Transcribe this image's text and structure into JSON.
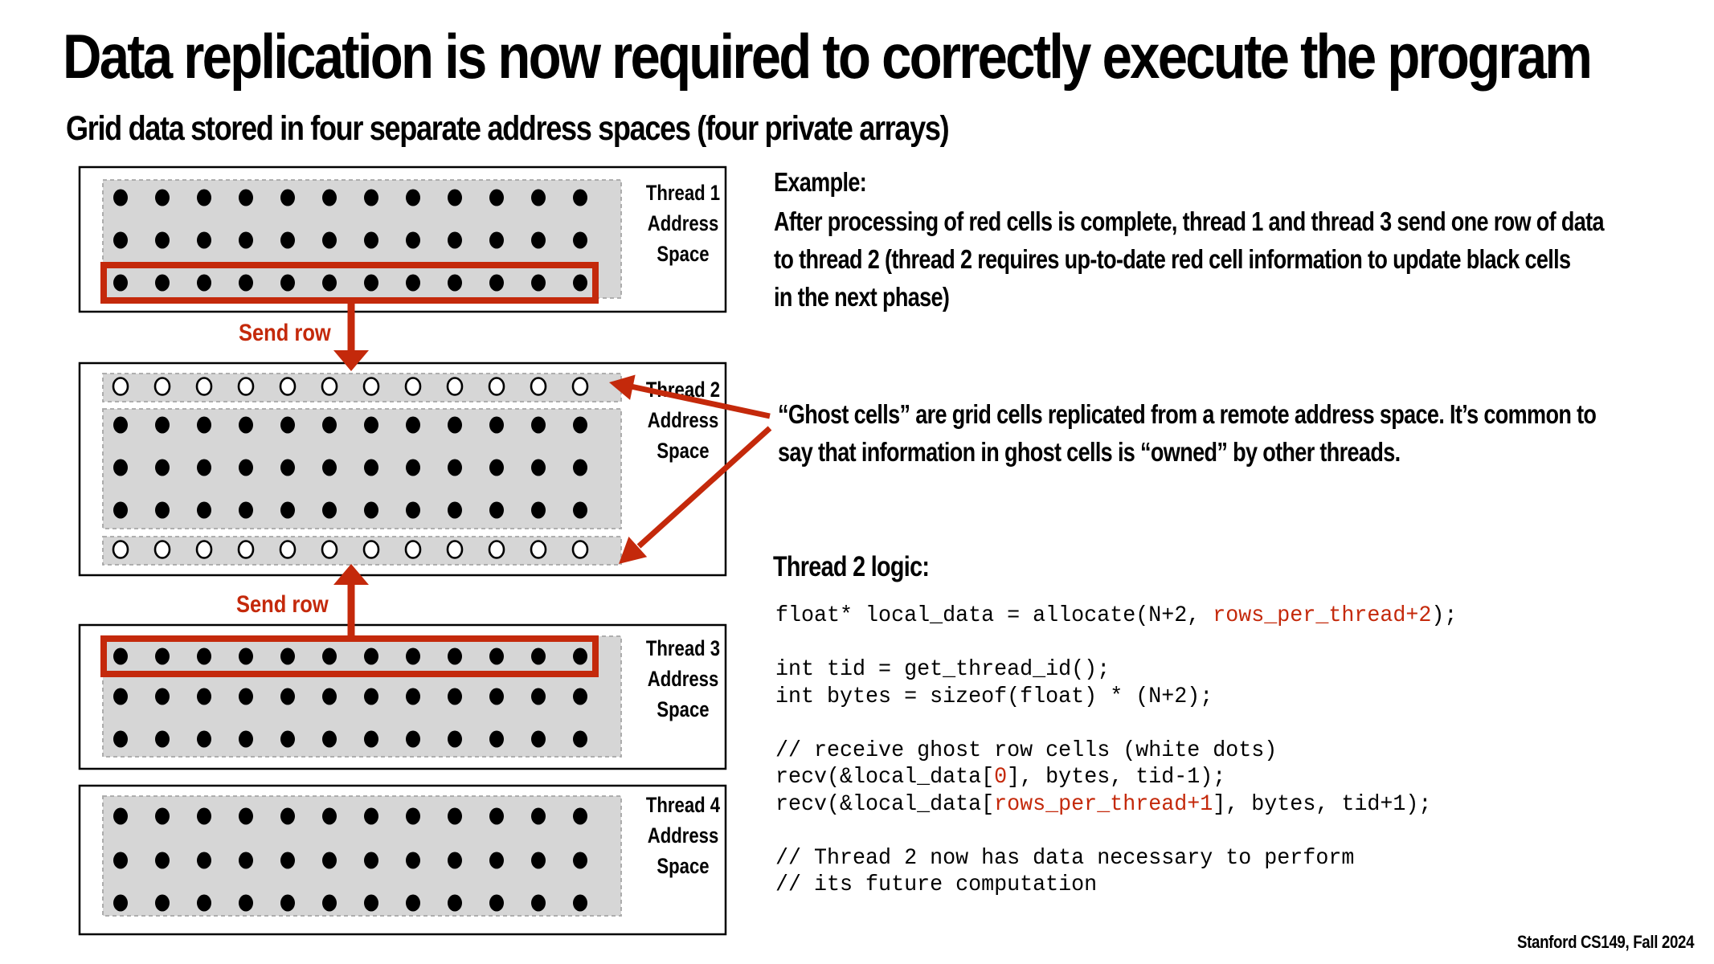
{
  "slide": {
    "title": "Data replication is now required to correctly execute the program",
    "subtitle": "Grid data stored in four separate address spaces (four private arrays)",
    "footer": "Stanford CS149, Fall 2024"
  },
  "colors": {
    "accent_red": "#c4290b",
    "grid_gray": "#d6d6d6",
    "text": "#000000"
  },
  "diagram": {
    "columns": 12,
    "threads": [
      {
        "label_lines": [
          "Thread 1",
          "Address",
          "Space"
        ],
        "rows": [
          "owned",
          "owned",
          "owned"
        ],
        "send_row_index": 2
      },
      {
        "label_lines": [
          "Thread 2",
          "Address",
          "Space"
        ],
        "rows": [
          "ghost",
          "owned",
          "owned",
          "owned",
          "ghost"
        ],
        "send_row_index": null
      },
      {
        "label_lines": [
          "Thread 3",
          "Address",
          "Space"
        ],
        "rows": [
          "owned",
          "owned",
          "owned"
        ],
        "send_row_index": 0
      },
      {
        "label_lines": [
          "Thread 4",
          "Address",
          "Space"
        ],
        "rows": [
          "owned",
          "owned",
          "owned"
        ],
        "send_row_index": null
      }
    ],
    "send_labels": [
      "Send row",
      "Send row"
    ]
  },
  "example": {
    "heading": "Example:",
    "lines": [
      "After processing of red cells is complete, thread 1 and thread 3 send one row of data",
      "to thread 2 (thread 2 requires up-to-date red cell information to update black cells",
      "in the next phase)"
    ]
  },
  "ghost_note": {
    "lines": [
      "“Ghost cells” are grid cells replicated from a remote address space.  It’s common to",
      "say that information in ghost cells is “owned” by other threads."
    ]
  },
  "logic": {
    "heading": "Thread 2 logic:",
    "code_lines": [
      [
        {
          "t": "float* local_data = allocate(N+2, "
        },
        {
          "t": "rows_per_thread+2",
          "red": true
        },
        {
          "t": ");"
        }
      ],
      [],
      [
        {
          "t": "int tid = get_thread_id();"
        }
      ],
      [
        {
          "t": "int bytes = sizeof(float) * (N+2);"
        }
      ],
      [],
      [
        {
          "t": "// receive ghost row cells (white dots)"
        }
      ],
      [
        {
          "t": "recv(&local_data["
        },
        {
          "t": "0",
          "red": true
        },
        {
          "t": "], bytes, tid-1);"
        }
      ],
      [
        {
          "t": "recv(&local_data["
        },
        {
          "t": "rows_per_thread+1",
          "red": true
        },
        {
          "t": "], bytes, tid+1);"
        }
      ],
      [],
      [
        {
          "t": "// Thread 2 now has data necessary to perform"
        }
      ],
      [
        {
          "t": "// its future computation"
        }
      ]
    ]
  }
}
